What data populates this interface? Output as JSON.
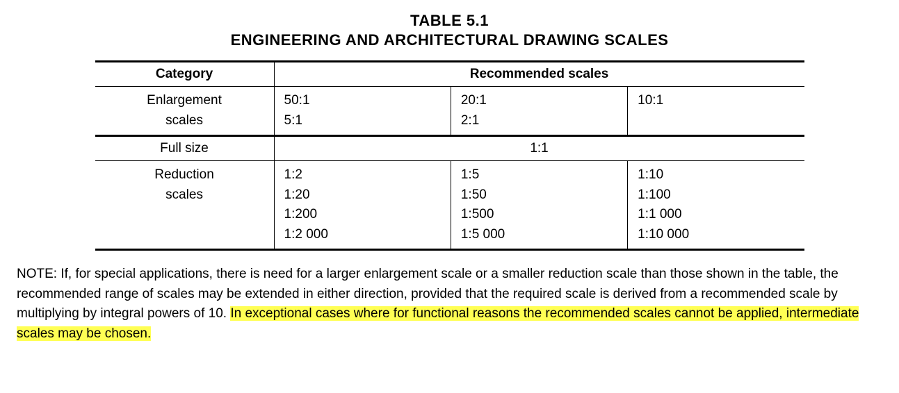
{
  "title": {
    "line1": "TABLE 5.1",
    "line2": "ENGINEERING AND ARCHITECTURAL DRAWING SCALES"
  },
  "headers": {
    "category": "Category",
    "recommended": "Recommended scales"
  },
  "rows": {
    "enlargement": {
      "label_line1": "Enlargement",
      "label_line2": "scales",
      "c1_l1": "50:1",
      "c1_l2": "5:1",
      "c2_l1": "20:1",
      "c2_l2": "2:1",
      "c3_l1": "10:1",
      "c3_l2": ""
    },
    "fullsize": {
      "label": "Full size",
      "value": "1:1"
    },
    "reduction": {
      "label_line1": "Reduction",
      "label_line2": "scales",
      "c1_l1": "1:2",
      "c1_l2": "1:20",
      "c1_l3": "1:200",
      "c1_l4": "1:2 000",
      "c2_l1": "1:5",
      "c2_l2": "1:50",
      "c2_l3": "1:500",
      "c2_l4": "1:5 000",
      "c3_l1": "1:10",
      "c3_l2": "1:100",
      "c3_l3": "1:1 000",
      "c3_l4": "1:10 000"
    }
  },
  "note": {
    "plain1": "NOTE: If, for special applications, there is need for a larger enlargement scale or a smaller reduction scale than those shown in the table, the recommended range of scales may be extended in either direction, provided that the required scale is derived from a recommended scale by multiplying by integral powers of 10. ",
    "highlight": "In exceptional cases where for functional reasons the recommended scales cannot be applied, intermediate scales may be chosen."
  }
}
